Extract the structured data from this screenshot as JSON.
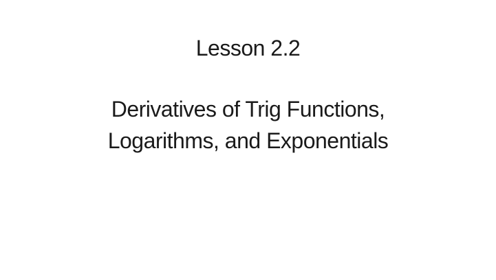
{
  "slide": {
    "background_color": "#ffffff",
    "text_color": "#1a1a1a",
    "title_lines": [
      "Lesson 2.2",
      "Derivatives of Trig Functions,",
      "Logarithms, and Exponentials"
    ]
  }
}
